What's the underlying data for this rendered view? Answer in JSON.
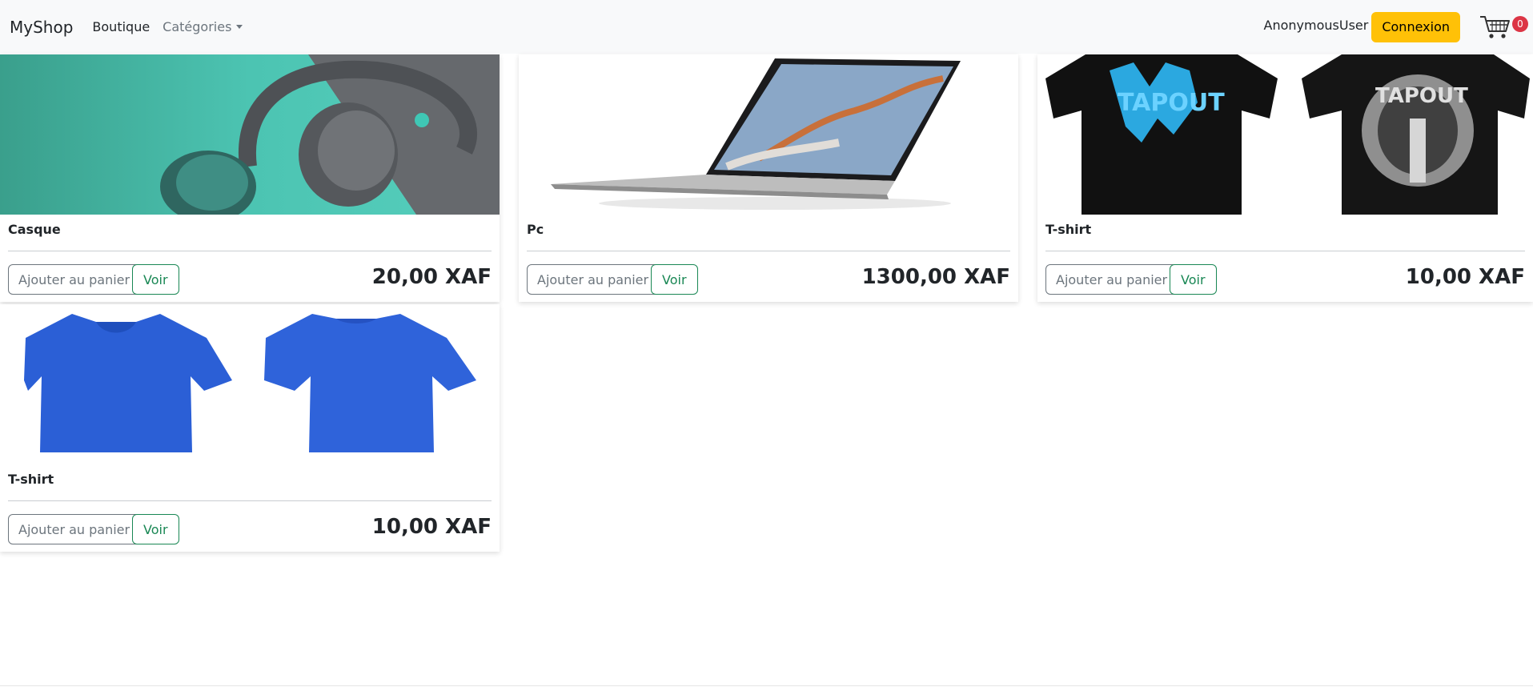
{
  "navbar": {
    "brand": "MyShop",
    "links": [
      {
        "label": "Boutique"
      },
      {
        "label": "Catégories"
      }
    ],
    "user": "AnonymousUser",
    "login_label": "Connexion",
    "cart_count": "0"
  },
  "products": [
    {
      "name": "Casque",
      "price": "20,00 XAF",
      "add_label": "Ajouter au panier",
      "view_label": "Voir",
      "image": "headphones"
    },
    {
      "name": "Pc",
      "price": "1300,00 XAF",
      "add_label": "Ajouter au panier",
      "view_label": "Voir",
      "image": "laptop"
    },
    {
      "name": "T-shirt",
      "price": "10,00 XAF",
      "add_label": "Ajouter au panier",
      "view_label": "Voir",
      "image": "black-tshirts"
    },
    {
      "name": "T-shirt",
      "price": "10,00 XAF",
      "add_label": "Ajouter au panier",
      "view_label": "Voir",
      "image": "blue-tshirts"
    }
  ],
  "colors": {
    "navbar_bg": "#f8f9fa",
    "warning": "#ffc107",
    "success": "#198754",
    "secondary": "#6c757d",
    "badge": "#dc3545"
  }
}
